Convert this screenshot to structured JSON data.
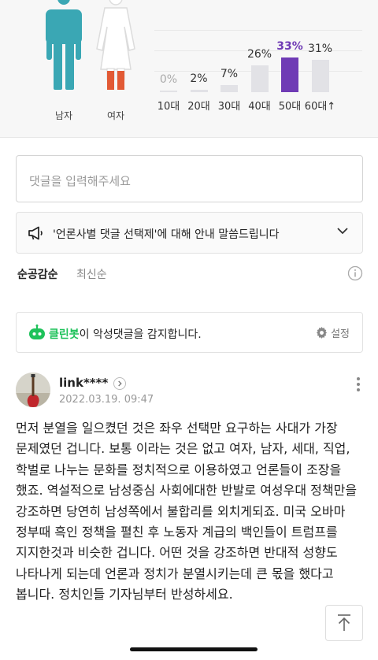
{
  "gender": {
    "male_label": "남자",
    "female_label": "여자"
  },
  "age_chart": {
    "groups": [
      {
        "label": "10대",
        "percent": "0%",
        "value": 0
      },
      {
        "label": "20대",
        "percent": "2%",
        "value": 2
      },
      {
        "label": "30대",
        "percent": "7%",
        "value": 7
      },
      {
        "label": "40대",
        "percent": "26%",
        "value": 26
      },
      {
        "label": "50대",
        "percent": "33%",
        "value": 33,
        "highlight": true
      },
      {
        "label": "60대↑",
        "percent": "31%",
        "value": 31
      }
    ],
    "highlight_color": "#6f3bb5",
    "bar_color": "#e2e2e6"
  },
  "comment_input": {
    "placeholder": "댓글을 입력해주세요"
  },
  "notice": {
    "text": "'언론사별 댓글 선택제'에 대해 안내 말씀드립니다"
  },
  "sort": {
    "active": "순공감순",
    "inactive": "최신순"
  },
  "cleanbot": {
    "brand": "클린봇",
    "message": "이 악성댓글을 감지합니다.",
    "settings_label": "설정",
    "brand_color": "#1ec25a"
  },
  "comment": {
    "username": "link****",
    "timestamp": "2022.03.19. 09:47",
    "body": "먼저 분열을 일으켰던 것은 좌우 선택만 요구하는 사대가 가장 문제였던 겁니다. 보통 이라는 것은 없고 여자, 남자, 세대, 직업, 학벌로 나누는 문화를 정치적으로 이용하였고 언론들이 조장을 했죠. 역설적으로 남성중심 사회에대한 반발로 여성우대 정책만을 강조하면 당연히 남성쪽에서 불합리를 외치게되죠. 미국 오바마 정부때 흑인 정책을 펼친 후 노동자 계급의 백인들이 트럼프를 지지한것과 비슷한 겁니다. 어떤 것을 강조하면 반대적 성향도 나타나게 되는데 언론과 정치가 분열시키는데 큰 몫을 했다고 봅니다. 정치인들 기자님부터 반성하세요."
  }
}
